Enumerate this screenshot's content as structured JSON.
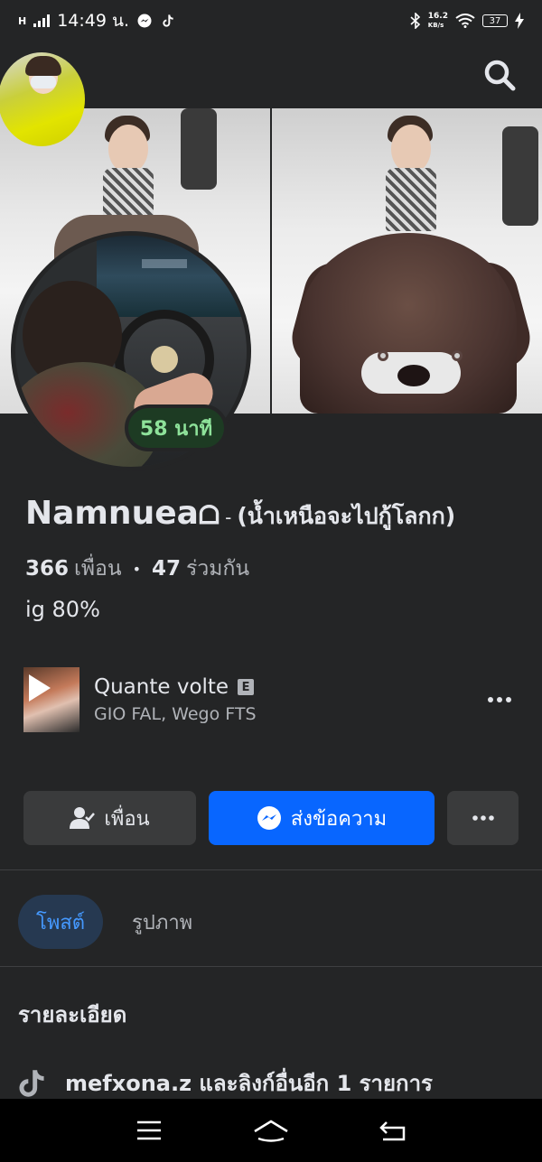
{
  "status_bar": {
    "network": "H",
    "time": "14:49 น.",
    "net_speed_value": "16.2",
    "net_speed_unit": "KB/s",
    "battery": "37"
  },
  "profile": {
    "active_badge": "58 นาที",
    "name": "Namnuea",
    "name_symbol": "ᗝ",
    "name_separator": "-",
    "alternate_name": "(น้ำเหนือจะไปกู้โลกก)",
    "friends_count": "366",
    "friends_label": "เพื่อน",
    "stat_separator": "•",
    "mutual_count": "47",
    "mutual_label": "ร่วมกัน",
    "bio": "ig 80%"
  },
  "music": {
    "title": "Quante volte",
    "explicit_badge": "E",
    "artist": "GIO FAL, Wego FTS"
  },
  "actions": {
    "friends_label": "เพื่อน",
    "message_label": "ส่งข้อความ"
  },
  "tabs": [
    {
      "label": "โพสต์",
      "active": true
    },
    {
      "label": "รูปภาพ",
      "active": false
    }
  ],
  "details": {
    "title": "รายละเอียด",
    "tiktok_text": "mefxona.z และลิงก์อื่นอีก 1 รายการ"
  },
  "colors": {
    "background": "#242526",
    "accent_blue": "#0866ff",
    "active_tab_text": "#4599ff",
    "active_badge_text": "#8ee29a"
  },
  "icons": [
    "search-icon",
    "add-friend-icon",
    "messenger-icon",
    "more-icon",
    "tiktok-icon",
    "play-icon",
    "menu-nav-icon",
    "home-nav-icon",
    "back-nav-icon"
  ]
}
